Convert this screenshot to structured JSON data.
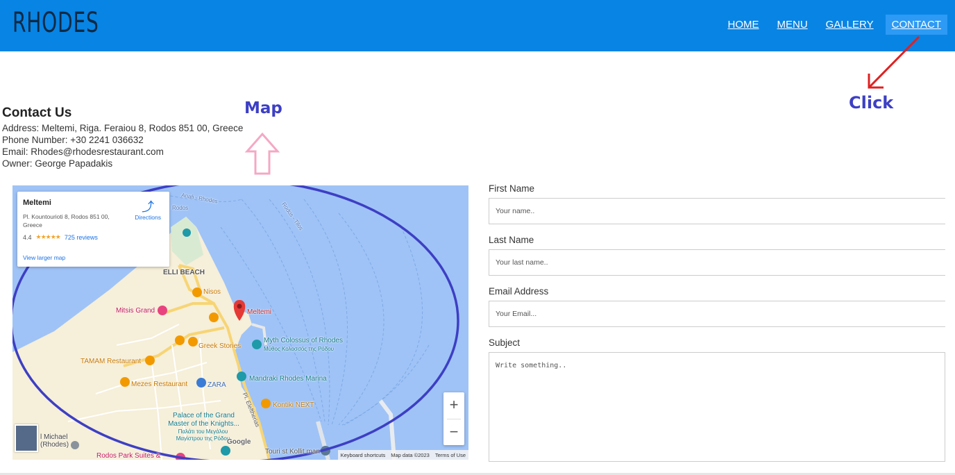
{
  "header": {
    "brand": "RHODES",
    "nav": [
      {
        "label": "HOME",
        "active": false
      },
      {
        "label": "MENU",
        "active": false
      },
      {
        "label": "GALLERY",
        "active": false
      },
      {
        "label": "CONTACT",
        "active": true
      }
    ]
  },
  "annotations": {
    "click_label": "Click",
    "map_label": "Map"
  },
  "contact": {
    "heading": "Contact Us",
    "address": "Address: Meltemi, Riga. Feraiou 8, Rodos 851 00, Greece",
    "phone": "Phone Number: +30 2241 036632",
    "email": "Email: Rhodes@rhodesrestaurant.com",
    "owner": "Owner: George Papadakis"
  },
  "map": {
    "place_card": {
      "name": "Meltemi",
      "address": "Pl. Kountourioti 8, Rodos 851 00, Greece",
      "rating": "4.4",
      "stars": "★★★★★",
      "reviews": "725 reviews",
      "directions": "Directions",
      "larger_map": "View larger map"
    },
    "labels": {
      "elli_beach": "ELLI BEACH",
      "nisos": "Nisos",
      "meltemi": "Meltemi",
      "mitsis": "Mitsis Grand",
      "greek_stories": "Greek Stories",
      "colossus": "Myth Colossus of Rhodes",
      "colossus_gr": "Μύθος Κολοσσός της Ρόδου",
      "tamam": "TAMAM Restaurant",
      "mezes": "Mezes Restaurant",
      "zara": "ZARA",
      "mandraki": "Mandraki Rhodes Marina",
      "kontiki": "Kontiki NEXT",
      "palace": "Palace of the Grand Master of the Knights...",
      "palace_gr": "Παλάτι του Μεγάλου Μαγίστρου της Ρόδου",
      "rodos_tilos": "Rodos - Tilos",
      "rodos": "Rodos",
      "anafi": "Anafi - Rhodes",
      "eleftherias": "Pl. Eleftherias",
      "michael": "l Michael (Rhodes)",
      "rodos_park": "Rodos Park Suites &",
      "google": "Google",
      "tourist": "Touri st Kollit man"
    },
    "zoom_in": "+",
    "zoom_out": "−",
    "footer": {
      "shortcuts": "Keyboard shortcuts",
      "mapdata": "Map data ©2023",
      "terms": "Terms of Use"
    }
  },
  "form": {
    "first_name_label": "First Name",
    "first_name_placeholder": "Your name..",
    "last_name_label": "Last Name",
    "last_name_placeholder": "Your last name..",
    "email_label": "Email Address",
    "email_placeholder": "Your Email...",
    "subject_label": "Subject",
    "subject_placeholder": "Write something.."
  },
  "colors": {
    "header_bg": "#0884e4",
    "active_nav_bg": "#2d9af5",
    "annotation_blue": "#3d3fc4",
    "annotation_red": "#e02020",
    "map_water": "#9fc3f6",
    "map_land": "#f6efd9"
  }
}
